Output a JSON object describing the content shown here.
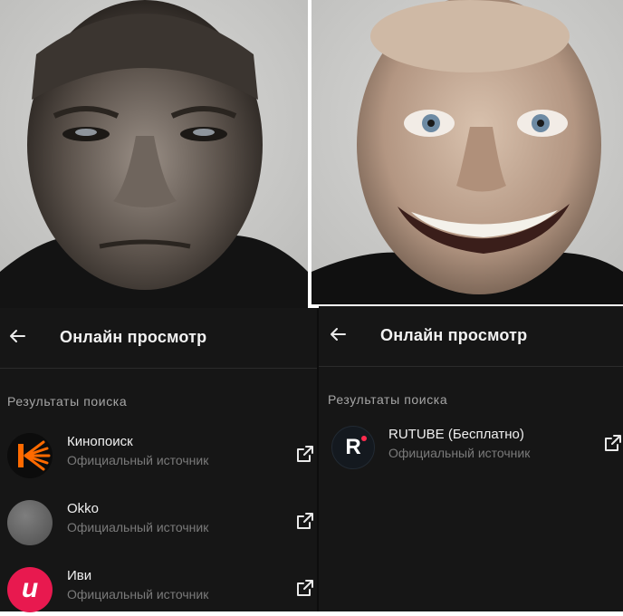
{
  "left_panel": {
    "title": "Онлайн просмотр",
    "section_label": "Результаты поиска",
    "results": [
      {
        "name": "Кинопоиск",
        "subtitle": "Официальный источник",
        "icon": "kinopoisk-logo",
        "color": "#ff6a00"
      },
      {
        "name": "Okko",
        "subtitle": "Официальный источник",
        "icon": "okko-logo",
        "color": "#6a6a6a"
      },
      {
        "name": "Иви",
        "subtitle": "Официальный источник",
        "icon": "ivi-logo",
        "color": "#e8194f",
        "logo_text": "и"
      }
    ]
  },
  "right_panel": {
    "title": "Онлайн просмотр",
    "section_label": "Результаты поиска",
    "results": [
      {
        "name": "RUTUBE (Бесплатно)",
        "subtitle": "Официальный источник",
        "icon": "rutube-logo",
        "color": "#14191f",
        "logo_text": "R",
        "accent": "#ff2b4e"
      }
    ]
  },
  "icons": {
    "back": "arrow-left-icon",
    "open": "open-external-icon"
  },
  "colors": {
    "panel_bg": "#161616",
    "text": "#f0f0f0",
    "muted": "#7a7a7a"
  }
}
